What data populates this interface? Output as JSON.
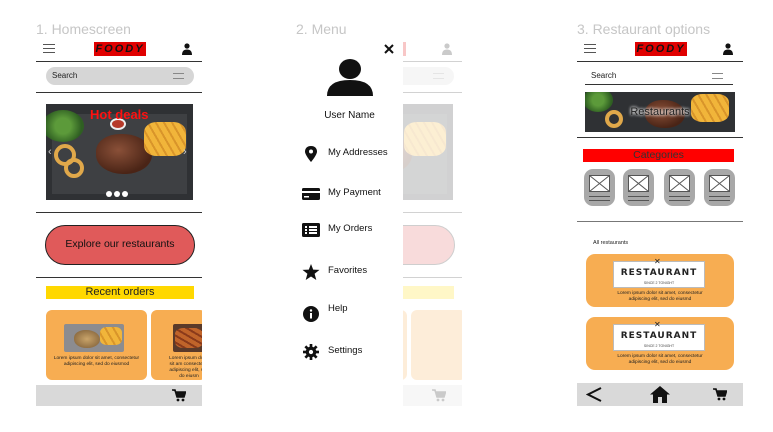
{
  "frames": [
    {
      "title": "1. Homescreen"
    },
    {
      "title": "2. Menu"
    },
    {
      "title": "3. Restaurant options"
    }
  ],
  "header": {
    "logo_text": "FOODY"
  },
  "search": {
    "label": "Search"
  },
  "home": {
    "hero_label": "Hot deals",
    "explore_label": "Explore our restaurants",
    "recent_orders_label": "Recent orders",
    "order_card_text": "Lorem ipsum dolor sit amet, consectetur adipiscing elit, sed do eiusmod",
    "order_card_text_partial": "Lorem ipsum dolor sit am consectetur adipiscing elit, sed do eiusm"
  },
  "menu": {
    "user_name": "User Name",
    "items": [
      {
        "label": "My Addresses",
        "icon": "location-pin-icon"
      },
      {
        "label": "My Payment",
        "icon": "credit-card-icon"
      },
      {
        "label": "My Orders",
        "icon": "list-icon"
      },
      {
        "label": "Favorites",
        "icon": "star-icon"
      },
      {
        "label": "Help",
        "icon": "info-icon"
      },
      {
        "label": "Settings",
        "icon": "gear-icon"
      }
    ],
    "close_icon": "close-icon"
  },
  "restaurants": {
    "hero_label": "Restaurants",
    "categories_label": "Categories",
    "all_label": "All restaurants",
    "cards": [
      {
        "sign_text": "RESTAURANT",
        "sub_text": "SINCE 2 TONIGHT",
        "description": "Lorem ipsum dolor sit amet, consectetur adipiscing elit, sed do eiusmd"
      },
      {
        "sign_text": "RESTAURANT",
        "sub_text": "SINCE 2 TONIGHT",
        "description": "Lorem ipsum dolor sit amet, consectetur adipiscing elit, sed do eiusmd"
      }
    ]
  },
  "colors": {
    "logo_red": "#e00000",
    "hot_deals_red": "#ff1010",
    "explore_button": "#e05a5a",
    "recent_orders_yellow": "#ffd800",
    "card_orange": "#f7ad52",
    "categories_red": "#ff0000",
    "bottom_bar": "#d9d9d9"
  }
}
